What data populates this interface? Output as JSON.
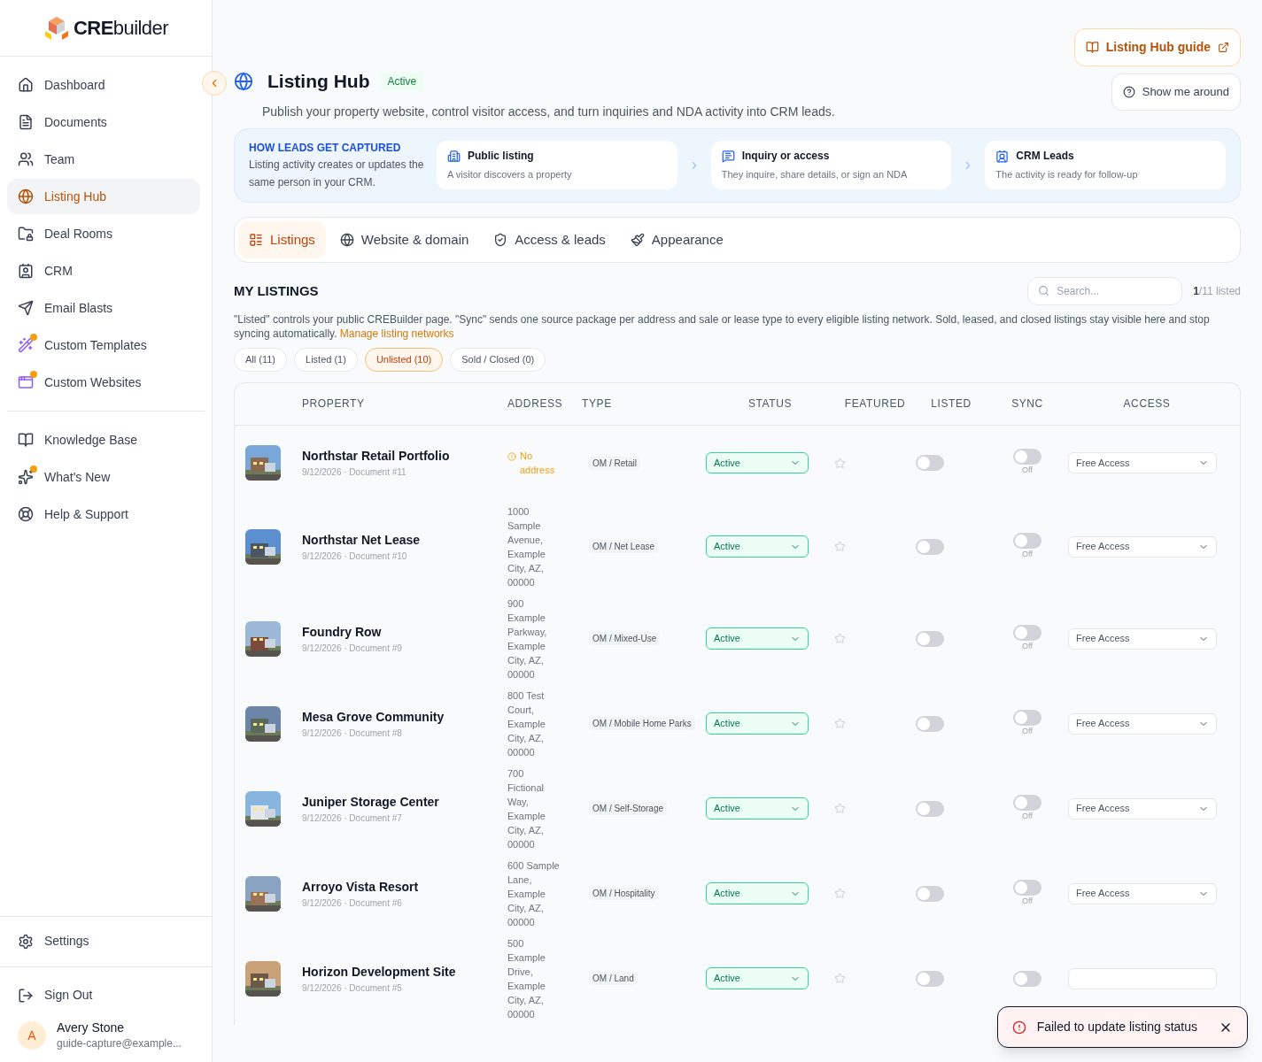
{
  "sidebar": {
    "logo": "**CRE**builder",
    "items": [
      {
        "label": "Dashboard",
        "selected": false,
        "dot": false
      },
      {
        "label": "Documents",
        "selected": false,
        "dot": false
      },
      {
        "label": "Team",
        "selected": false,
        "dot": false
      },
      {
        "label": "Listing Hub",
        "selected": true,
        "dot": false
      },
      {
        "label": "Deal Rooms",
        "selected": false,
        "dot": false
      },
      {
        "label": "CRM",
        "selected": false,
        "dot": false
      },
      {
        "label": "Email Blasts",
        "selected": false,
        "dot": false
      },
      {
        "label": "Custom Templates",
        "selected": false,
        "dot": true
      },
      {
        "label": "Custom Websites",
        "selected": false,
        "dot": true
      }
    ],
    "secondary_items": [
      {
        "label": "Knowledge Base",
        "selected": false,
        "dot": false
      },
      {
        "label": "What's New",
        "selected": false,
        "dot": true
      },
      {
        "label": "Help & Support",
        "selected": false,
        "dot": false
      }
    ],
    "settings": "Settings",
    "sign_out": "Sign Out",
    "user": {
      "initial": "A",
      "name": "Avery Stone",
      "email": "guide-capture@example..."
    }
  },
  "header": {
    "title": "Listing Hub",
    "badge": "Active",
    "subtitle": "Publish your property website, control visitor access, and turn inquiries and NDA activity into CRM leads.",
    "guide_button": "Listing Hub guide",
    "tour_button": "Show me around"
  },
  "capture_banner": {
    "heading": "HOW LEADS GET CAPTURED",
    "text": "Listing activity creates or updates the same person in your CRM.",
    "steps": [
      {
        "title": "Public listing",
        "text": "A visitor discovers a property"
      },
      {
        "title": "Inquiry or access",
        "text": "They inquire, share details, or sign an NDA"
      },
      {
        "title": "CRM Leads",
        "text": "The activity is ready for follow-up"
      }
    ]
  },
  "tabs": [
    {
      "label": "Listings",
      "selected": true
    },
    {
      "label": "Website & domain",
      "selected": false
    },
    {
      "label": "Access & leads",
      "selected": false
    },
    {
      "label": "Appearance",
      "selected": false
    }
  ],
  "listings": {
    "heading": "MY LISTINGS",
    "search_placeholder": "Search...",
    "listed_count": "1",
    "listed_total": "/11 listed",
    "description": "\"Listed\" controls your public CREBuilder page. \"Sync\" sends one source package per address and sale or lease type to every eligible listing network. Sold, leased, and closed listings stay visible here and stop syncing automatically.",
    "manage_link": "Manage listing networks",
    "filters": [
      {
        "label": "All (11)",
        "selected": false
      },
      {
        "label": "Listed (1)",
        "selected": false
      },
      {
        "label": "Unlisted (10)",
        "selected": true
      },
      {
        "label": "Sold / Closed (0)",
        "selected": false
      }
    ]
  },
  "table": {
    "columns": [
      "PROPERTY",
      "ADDRESS",
      "TYPE",
      "STATUS",
      "FEATURED",
      "LISTED",
      "SYNC",
      "ACCESS"
    ],
    "rows": [
      {
        "name": "Northstar Retail Portfolio",
        "meta": "9/12/2026 · Document #11",
        "address": "No address",
        "address_missing": true,
        "type": "OM / Retail",
        "status": "Active",
        "featured": false,
        "listed": false,
        "sync": false,
        "sync_label": "Off",
        "access": "Free Access"
      },
      {
        "name": "Northstar Net Lease",
        "meta": "9/12/2026 · Document #10",
        "address": "1000 Sample Avenue, Example City, AZ, 00000",
        "address_missing": false,
        "type": "OM / Net Lease",
        "status": "Active",
        "featured": false,
        "listed": false,
        "sync": false,
        "sync_label": "Off",
        "access": "Free Access"
      },
      {
        "name": "Foundry Row",
        "meta": "9/12/2026 · Document #9",
        "address": "900 Example Parkway, Example City, AZ, 00000",
        "address_missing": false,
        "type": "OM / Mixed-Use",
        "status": "Active",
        "featured": false,
        "listed": false,
        "sync": false,
        "sync_label": "Off",
        "access": "Free Access"
      },
      {
        "name": "Mesa Grove Community",
        "meta": "9/12/2026 · Document #8",
        "address": "800 Test Court, Example City, AZ, 00000",
        "address_missing": false,
        "type": "OM / Mobile Home Parks",
        "status": "Active",
        "featured": false,
        "listed": false,
        "sync": false,
        "sync_label": "Off",
        "access": "Free Access"
      },
      {
        "name": "Juniper Storage Center",
        "meta": "9/12/2026 · Document #7",
        "address": "700 Fictional Way, Example City, AZ, 00000",
        "address_missing": false,
        "type": "OM / Self-Storage",
        "status": "Active",
        "featured": false,
        "listed": false,
        "sync": false,
        "sync_label": "Off",
        "access": "Free Access"
      },
      {
        "name": "Arroyo Vista Resort",
        "meta": "9/12/2026 · Document #6",
        "address": "600 Sample Lane, Example City, AZ, 00000",
        "address_missing": false,
        "type": "OM / Hospitality",
        "status": "Active",
        "featured": false,
        "listed": false,
        "sync": false,
        "sync_label": "Off",
        "access": "Free Access"
      },
      {
        "name": "Horizon Development Site",
        "meta": "9/12/2026 · Document #5",
        "address": "500 Example Drive, Example City, AZ, 00000",
        "address_missing": false,
        "type": "OM / Land",
        "status": "Active",
        "featured": false,
        "listed": false,
        "sync": false
      }
    ]
  },
  "toast": {
    "message": "Failed to update listing status"
  }
}
